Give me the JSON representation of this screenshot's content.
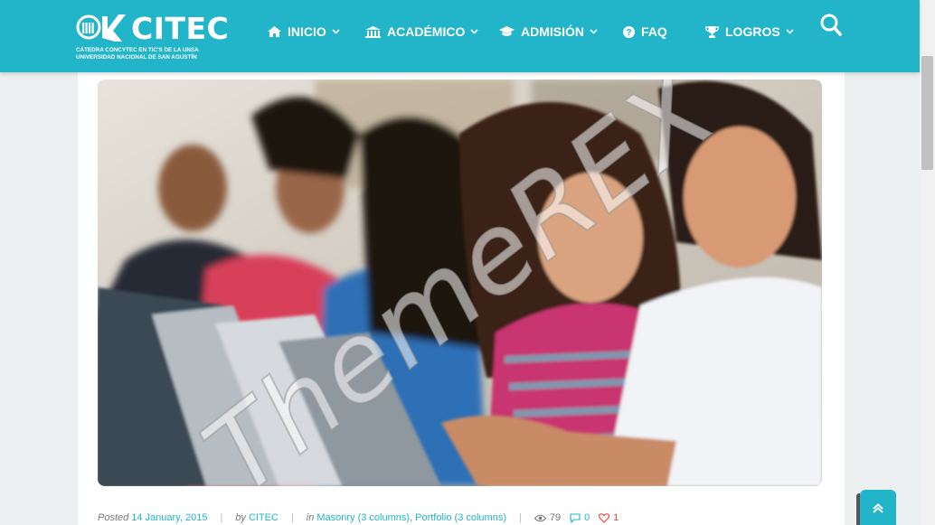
{
  "brand": {
    "name": "CITEC",
    "subtitle_line1": "CÁTEDRA CONCYTEC EN TIC'S DE LA UNSA",
    "subtitle_line2": "UNIVERSIDAD NACIONAL DE SAN AGUSTÍN"
  },
  "nav": {
    "items": [
      {
        "label": "INICIO",
        "icon": "home-icon",
        "has_dropdown": true
      },
      {
        "label": "ACADÉMICO",
        "icon": "institution-icon",
        "has_dropdown": true
      },
      {
        "label": "ADMISIÓN",
        "icon": "graduation-cap-icon",
        "has_dropdown": true
      },
      {
        "label": "FAQ",
        "icon": "question-circle-icon",
        "has_dropdown": false
      },
      {
        "label": "LOGROS",
        "icon": "trophy-icon",
        "has_dropdown": true
      }
    ],
    "search_icon": "search-icon"
  },
  "post": {
    "image_watermark": "ThemeREX",
    "posted_label": "Posted",
    "posted_date": "14 January, 2015",
    "by_label": "by",
    "author": "CITEC",
    "in_label": "in",
    "category_1": "Masonry (3 columns)",
    "category_separator": ",",
    "category_2": "Portfolio (3 columns)",
    "views": "79",
    "comments": "0",
    "likes": "1"
  },
  "colors": {
    "header_bg": "#22b5c9",
    "accent": "#22b5c9",
    "like_color": "#e74c3c"
  },
  "scroll_to_top_icon": "chevron-up-icon"
}
